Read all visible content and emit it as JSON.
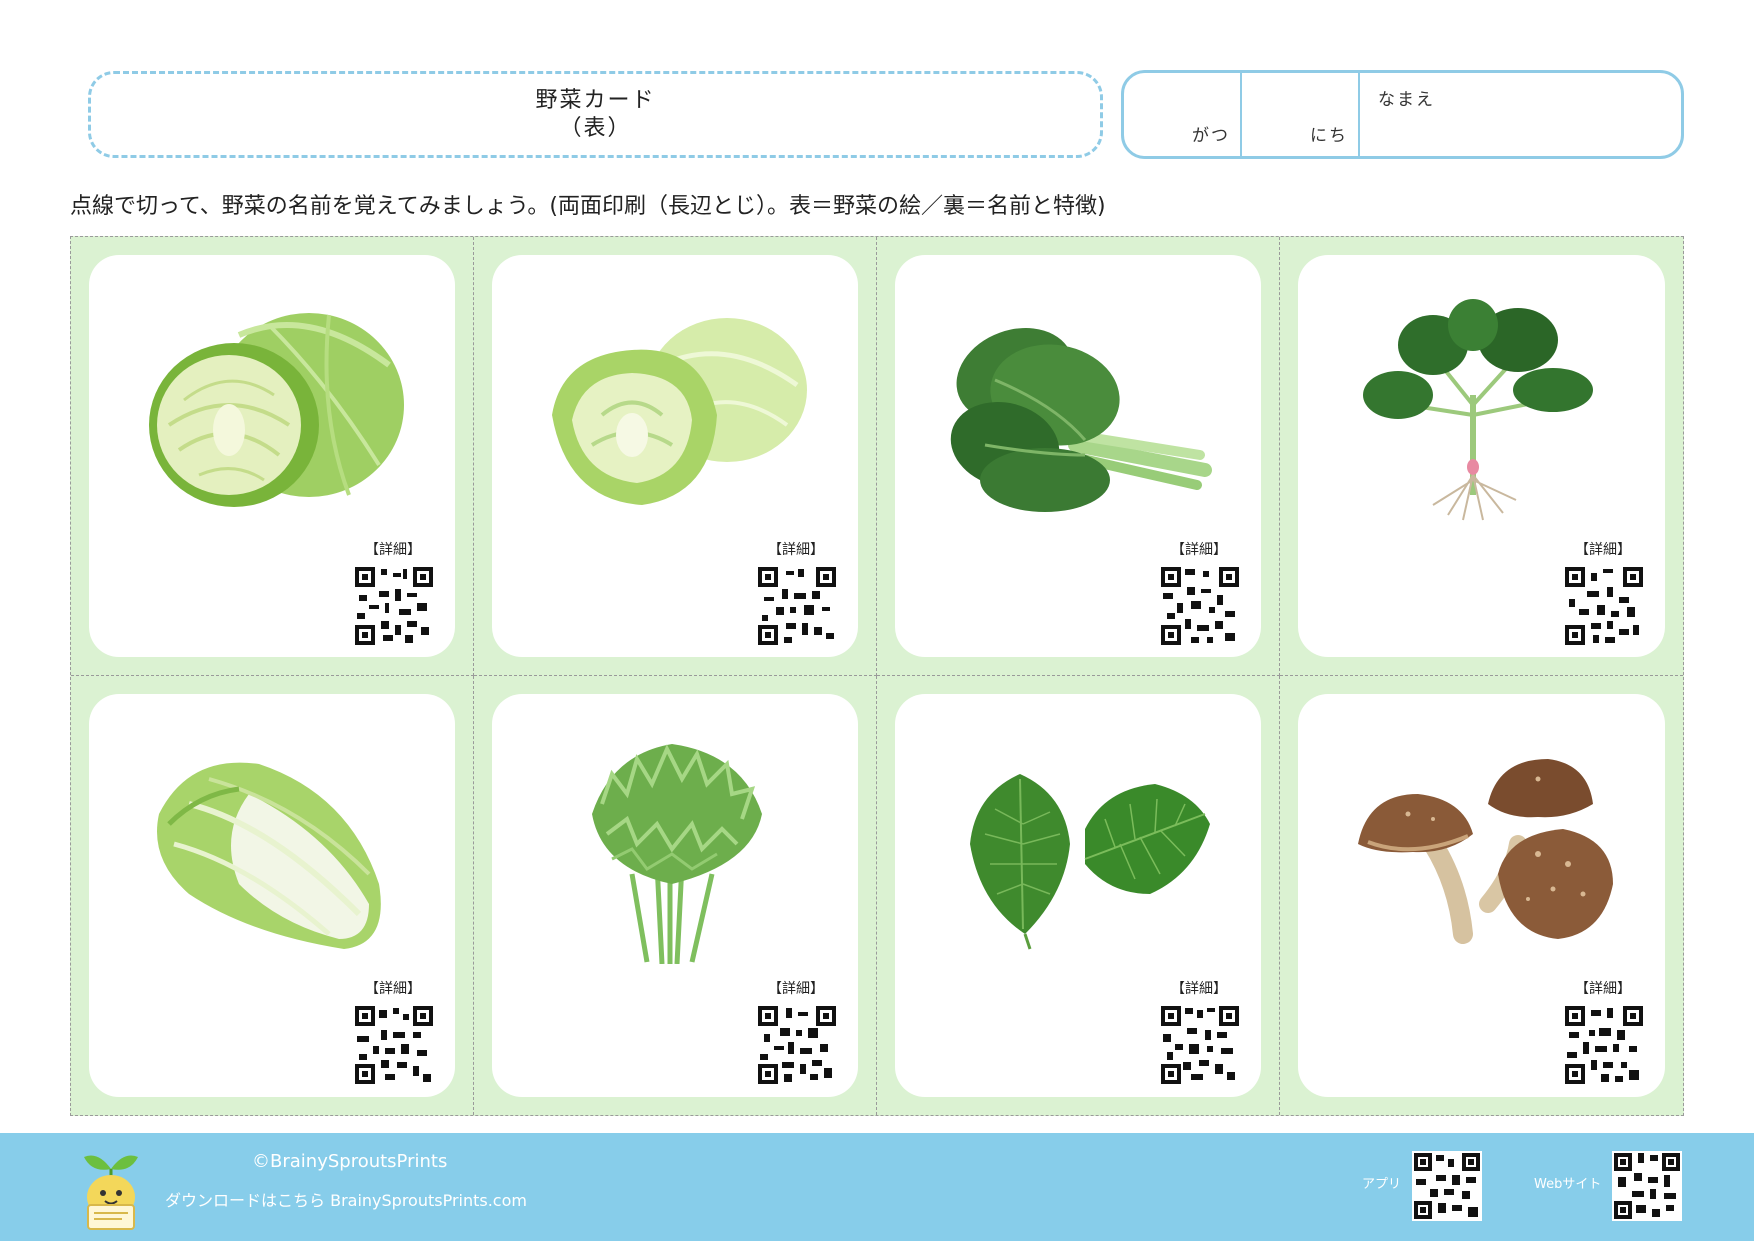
{
  "header": {
    "title": "野菜カード",
    "subtitle": "（表）",
    "month_label": "がつ",
    "day_label": "にち",
    "name_label": "なまえ"
  },
  "instructions": "点線で切って、野菜の名前を覚えてみましょう。(両面印刷（長辺とじ）。表＝野菜の絵／裏＝名前と特徴)",
  "cards": [
    {
      "icon": "cabbage-icon",
      "detail_label": "【詳細】"
    },
    {
      "icon": "lettuce-icon",
      "detail_label": "【詳細】"
    },
    {
      "icon": "komatsuna-icon",
      "detail_label": "【詳細】"
    },
    {
      "icon": "spinach-icon",
      "detail_label": "【詳細】"
    },
    {
      "icon": "napa-cabbage-icon",
      "detail_label": "【詳細】"
    },
    {
      "icon": "shungiku-icon",
      "detail_label": "【詳細】"
    },
    {
      "icon": "shiso-leaf-icon",
      "detail_label": "【詳細】"
    },
    {
      "icon": "shiitake-icon",
      "detail_label": "【詳細】"
    }
  ],
  "footer": {
    "copyright": "©BrainySproutsPrints",
    "download": "ダウンロードはこちら BrainySproutsPrints.com",
    "app_label": "アプリ",
    "web_label": "Webサイト"
  },
  "colors": {
    "accent_blue": "#8fcbe6",
    "grid_green": "#dbf2d2",
    "footer_blue": "#87cdea"
  }
}
